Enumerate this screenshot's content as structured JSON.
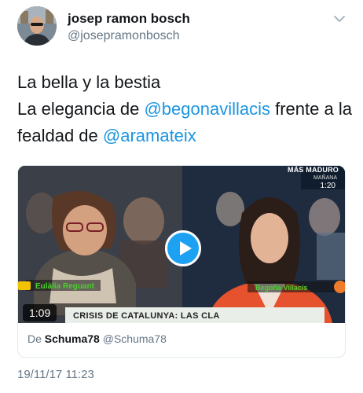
{
  "author": {
    "display_name": "josep ramon bosch",
    "handle": "@josepramonbosch",
    "avatar_icon": "avatar-photo"
  },
  "tweet": {
    "line1": "La bella y la bestia",
    "line2_prefix": "La elegancia de ",
    "line2_mention": "@begonavillacis",
    "line2_suffix": " frente a la",
    "line3_prefix": "fealdad de ",
    "line3_mention": "@aramateix"
  },
  "video": {
    "channel_title": "MÁS MADURO",
    "channel_sub": "MAÑANA",
    "channel_time": "1:20",
    "left_caption": "Eulàlia Reguant",
    "right_caption": "Begoña Villacís",
    "ticker": "CRISIS DE CATALUNYA: LAS CLA",
    "duration": "1:09",
    "play_icon": "play-icon"
  },
  "attribution": {
    "prefix": "De",
    "source_name": "Schuma78",
    "source_handle": "@Schuma78"
  },
  "timestamp": "19/11/17 11:23",
  "colors": {
    "link": "#1b95e0",
    "play_button": "#1da1f2",
    "secondary_text": "#657786",
    "caption_green": "#4bcf2f"
  }
}
